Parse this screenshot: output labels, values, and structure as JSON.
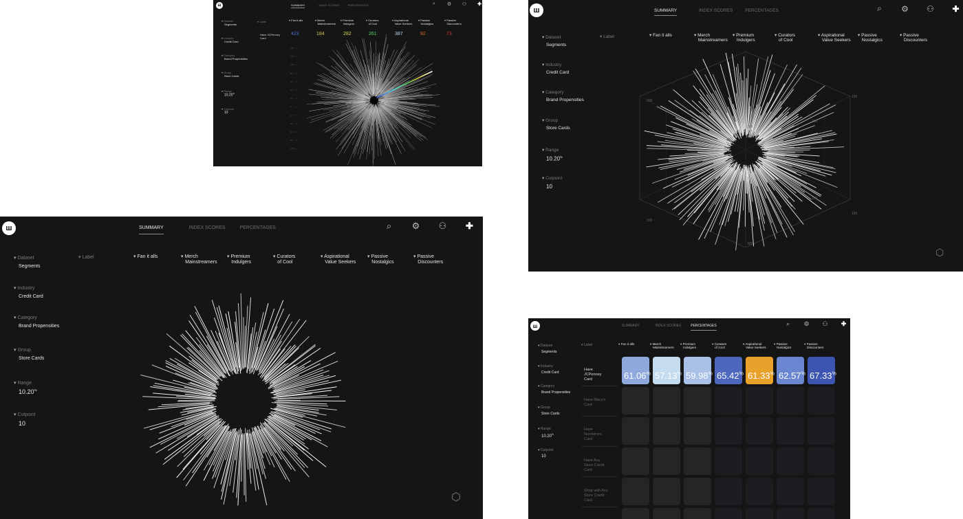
{
  "brand": {
    "logo_text": "ш"
  },
  "tabs": {
    "summary": "SUMMARY",
    "index_scores": "INDEX SCORES",
    "percentages": "PERCENTAGES"
  },
  "sidebar": {
    "dataset": {
      "label": "Dataset",
      "value": "Segments"
    },
    "industry": {
      "label": "Industry",
      "value": "Credit Card"
    },
    "category": {
      "label": "Category",
      "value": "Brand Propensities"
    },
    "group": {
      "label": "Group",
      "value": "Store Cards"
    },
    "range": {
      "label": "Range",
      "value": "10.20",
      "unit": "%"
    },
    "cutpoint": {
      "label": "Cutpoint",
      "value": "10"
    }
  },
  "label_header": "Label",
  "segments": [
    {
      "line1": "Fan it alls",
      "line2": ""
    },
    {
      "line1": "Merch",
      "line2": "Mainstreamers"
    },
    {
      "line1": "Premium",
      "line2": "Indulgers"
    },
    {
      "line1": "Curators",
      "line2": "of Cool"
    },
    {
      "line1": "Aspirational",
      "line2": "Value Seekers"
    },
    {
      "line1": "Passive",
      "line2": "Nostalgics"
    },
    {
      "line1": "Passive",
      "line2": "Discounters"
    }
  ],
  "summary_row_label": "Have JCPenney Card",
  "summary_scores": [
    {
      "value": "423",
      "color": "#4d6fd6"
    },
    {
      "value": "184",
      "color": "#d6c24d"
    },
    {
      "value": "282",
      "color": "#d6d24d"
    },
    {
      "value": "261",
      "color": "#4dd66a"
    },
    {
      "value": "387",
      "color": "#b7d3ef"
    },
    {
      "value": "92",
      "color": "#e0632f"
    },
    {
      "value": "73",
      "color": "#d63c3c"
    }
  ],
  "axis_ticks_left": [
    "140",
    "120",
    "100",
    "80",
    "60",
    "40",
    "20",
    "0",
    "20",
    "40",
    "60",
    "80",
    "100"
  ],
  "cube_ticks": [
    "300",
    "100",
    "300",
    "100",
    "300",
    "100",
    "300",
    "100"
  ],
  "percent_rows": [
    {
      "label": "Have JCPenney Card",
      "active": true
    },
    {
      "label": "Have Macy's Card",
      "active": false
    },
    {
      "label": "Have Nordstrom Card",
      "active": false
    },
    {
      "label": "Have Any Store Credit Card",
      "active": false
    },
    {
      "label": "Shop with Any Store Credit Card",
      "active": false
    }
  ],
  "percent_values": [
    {
      "value": "61.06",
      "color": "#8fa9dc"
    },
    {
      "value": "57.13",
      "color": "#c5dcef"
    },
    {
      "value": "59.98",
      "color": "#a9c1e6"
    },
    {
      "value": "65.42",
      "color": "#4d67bf"
    },
    {
      "value": "61.33",
      "color": "#e8a22c"
    },
    {
      "value": "62.57",
      "color": "#6b86d0"
    },
    {
      "value": "67.33",
      "color": "#3c55b0"
    }
  ],
  "percent_unit": "%",
  "colors": {
    "panel_bg": "#151515",
    "cell_empty_a": "#252525",
    "cell_empty_b": "#1d1d21"
  },
  "icons": [
    "search-icon",
    "gear-icon",
    "user-icon",
    "plus-icon",
    "cube-icon",
    "chevron-down-icon"
  ]
}
